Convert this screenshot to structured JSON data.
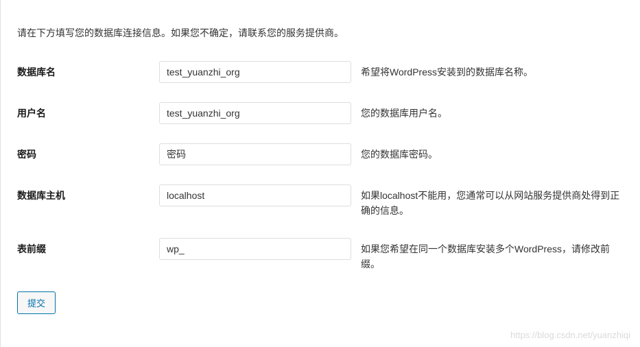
{
  "intro": "请在下方填写您的数据库连接信息。如果您不确定，请联系您的服务提供商。",
  "fields": {
    "dbname": {
      "label": "数据库名",
      "value": "test_yuanzhi_org",
      "help": "希望将WordPress安装到的数据库名称。"
    },
    "username": {
      "label": "用户名",
      "value": "test_yuanzhi_org",
      "help": "您的数据库用户名。"
    },
    "password": {
      "label": "密码",
      "placeholder": "密码",
      "help": "您的数据库密码。"
    },
    "dbhost": {
      "label": "数据库主机",
      "value": "localhost",
      "help": "如果localhost不能用，您通常可以从网站服务提供商处得到正确的信息。"
    },
    "prefix": {
      "label": "表前缀",
      "value": "wp_",
      "help": "如果您希望在同一个数据库安装多个WordPress，请修改前缀。"
    }
  },
  "submit_label": "提交",
  "watermark": "https://blog.csdn.net/yuanzhiqi"
}
